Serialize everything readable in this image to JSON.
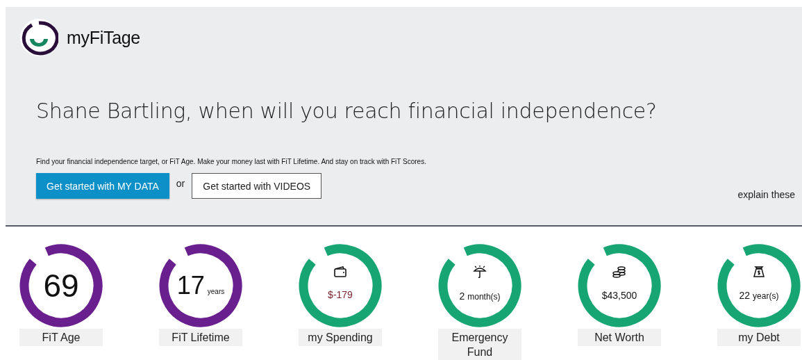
{
  "brand": {
    "name": "myFiTage"
  },
  "hero": {
    "heading": "Shane Bartling, when will you reach financial independence?",
    "text": "Find your financial independence target, or FiT Age. Make your money last with FiT Lifetime. And stay on track with FiT Scores.",
    "primary_button": "Get started with MY DATA",
    "separator": "or",
    "secondary_button": "Get started with VIDEOS",
    "link": "explain these"
  },
  "gauges": [
    {
      "kind": "plain",
      "color": "#6a1f8f",
      "value": "69",
      "label": "FiT Age",
      "negative": false
    },
    {
      "kind": "plain",
      "color": "#6a1f8f",
      "value": "17",
      "unit": "years",
      "label": "FiT Lifetime",
      "negative": false
    },
    {
      "kind": "wallet",
      "color": "#17a673",
      "value": "$-179",
      "label": "my Spending",
      "negative": true
    },
    {
      "kind": "umbrella",
      "color": "#17a673",
      "value": "2",
      "unit": "month(s)",
      "label": "Emergency Fund",
      "negative": false
    },
    {
      "kind": "coins",
      "color": "#17a673",
      "value": "$43,500",
      "label": "Net Worth",
      "negative": false
    },
    {
      "kind": "bag",
      "color": "#17a673",
      "value": "22",
      "unit": "year(s)",
      "label": "my Debt",
      "negative": false
    }
  ]
}
